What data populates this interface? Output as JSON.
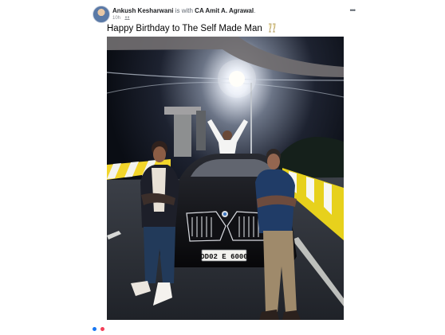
{
  "post": {
    "author": "Ankush Kesharwani",
    "with_text": "is with",
    "with_name": "CA Amit A. Agrawal",
    "with_suffix": ".",
    "time": "10h",
    "audience_icon": "friends-icon",
    "more_icon": "more-options-icon",
    "caption": "Happy Birthday to The Self Made Man",
    "caption_emoji": "clinking-glasses-icon",
    "photo": {
      "license_plate": "DD02 E 6000",
      "car": "black-suv",
      "people_count": 3
    },
    "reaction_icons": [
      "like-icon",
      "love-icon"
    ],
    "colors": {
      "author_text": "#1c1e21",
      "meta_text": "#606770"
    }
  }
}
